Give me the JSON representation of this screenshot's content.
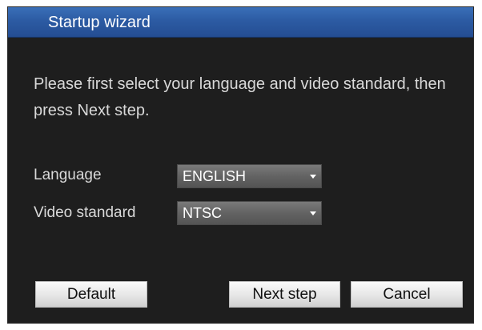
{
  "window": {
    "title": "Startup wizard"
  },
  "message": "Please first select your language and video standard, then press Next step.",
  "fields": {
    "language": {
      "label": "Language",
      "value": "ENGLISH"
    },
    "video_standard": {
      "label": "Video standard",
      "value": "NTSC"
    }
  },
  "buttons": {
    "default_label": "Default",
    "next_label": "Next step",
    "cancel_label": "Cancel"
  },
  "colors": {
    "title_bar": "#2c5ba3",
    "dialog_background": "#1e1e1e",
    "select_background": "#666666",
    "button_background": "#e6e6e6"
  }
}
